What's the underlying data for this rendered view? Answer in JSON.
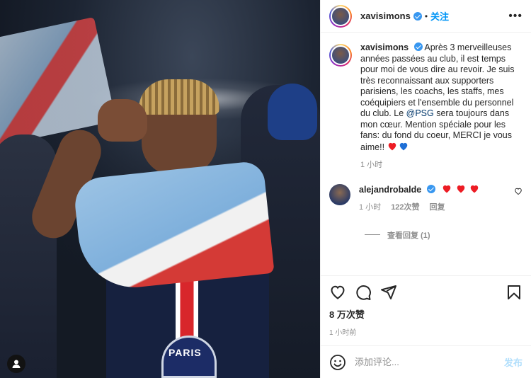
{
  "post": {
    "author": "xavisimons",
    "follow_label": "关注",
    "more_label": "•••",
    "caption": "Après 3 merveilleuses années passées au club, il est temps pour moi de vous dire au revoir. Je suis très reconnaissant aux supporters parisiens, les coachs, les staffs, mes coéquipiers et l'ensemble du personnel du club. Le",
    "mention": "@PSG",
    "caption_end": "sera toujours dans mon cœur. Mention spéciale pour les fans: du fond du coeur, MERCI je vous aime!!",
    "caption_time": "1 小时",
    "photo_badge_text": "PARIS"
  },
  "comments": [
    {
      "author": "alejandrobalde",
      "hearts": 3,
      "time": "1 小时",
      "likes": "122次赞",
      "reply_label": "回复",
      "view_replies": "查看回复 (1)"
    }
  ],
  "actions": {
    "likes_count": "8 万次赞",
    "posted_time": "1 小时前"
  },
  "add_comment": {
    "placeholder": "添加评论...",
    "post_label": "发布"
  },
  "colors": {
    "accent_blue": "#0095f6",
    "heart_red": "#ed1c24",
    "heart_blue": "#1f6fd6",
    "muted": "#8e8e8e"
  },
  "icons": [
    "verified-badge-icon",
    "more-icon",
    "heart-outline-icon",
    "comment-icon",
    "share-icon",
    "bookmark-icon",
    "emoji-icon",
    "user-tag-icon"
  ]
}
